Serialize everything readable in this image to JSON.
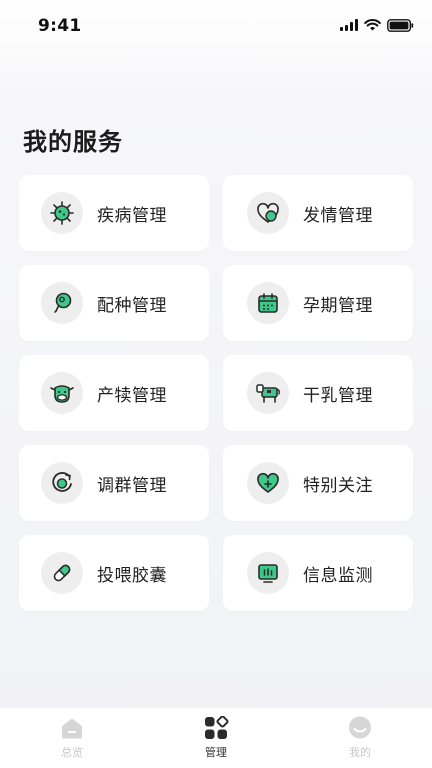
{
  "status_bar": {
    "time": "9:41"
  },
  "section": {
    "title": "我的服务"
  },
  "services": [
    {
      "label": "疾病管理",
      "icon": "virus-icon"
    },
    {
      "label": "发情管理",
      "icon": "heart-head-icon"
    },
    {
      "label": "配种管理",
      "icon": "sperm-icon"
    },
    {
      "label": "孕期管理",
      "icon": "calendar-icon"
    },
    {
      "label": "产犊管理",
      "icon": "calf-face-icon"
    },
    {
      "label": "干乳管理",
      "icon": "cow-icon"
    },
    {
      "label": "调群管理",
      "icon": "regroup-icon"
    },
    {
      "label": "特别关注",
      "icon": "heart-plus-icon"
    },
    {
      "label": "投喂胶囊",
      "icon": "capsule-icon"
    },
    {
      "label": "信息监测",
      "icon": "monitor-icon"
    }
  ],
  "tabs": [
    {
      "label": "总览",
      "icon": "home-icon",
      "active": false
    },
    {
      "label": "管理",
      "icon": "grid-icon",
      "active": true
    },
    {
      "label": "我的",
      "icon": "profile-icon",
      "active": false
    }
  ],
  "colors": {
    "accent_green": "#3ec98a",
    "icon_dark": "#2b2b2b"
  }
}
